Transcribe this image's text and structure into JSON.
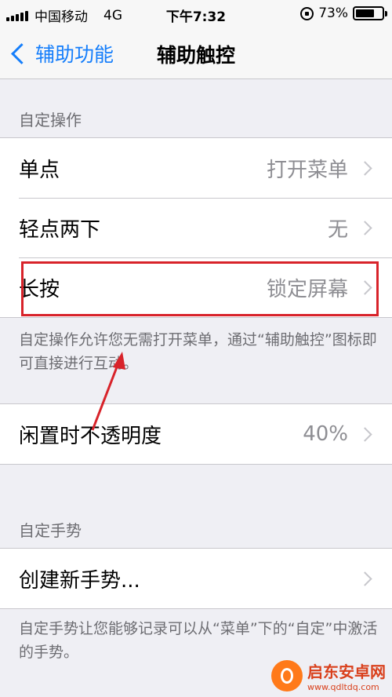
{
  "status_bar": {
    "carrier": "中国移动",
    "network": "4G",
    "time": "下午7:32",
    "battery_percent": "73%",
    "battery_level": 0.73,
    "signal_bars": 5
  },
  "nav": {
    "back_label": "辅助功能",
    "title": "辅助触控"
  },
  "custom_actions": {
    "header": "自定操作",
    "rows": [
      {
        "label": "单点",
        "value": "打开菜单"
      },
      {
        "label": "轻点两下",
        "value": "无"
      },
      {
        "label": "长按",
        "value": "锁定屏幕"
      }
    ],
    "footer": "自定操作允许您无需打开菜单，通过“辅助触控”图标即可直接进行互动。"
  },
  "opacity": {
    "label": "闲置时不透明度",
    "value": "40%"
  },
  "custom_gestures": {
    "header": "自定手势",
    "create_label": "创建新手势...",
    "footer": "自定手势让您能够记录可以从“菜单”下的“自定”中激活的手势。"
  },
  "annotation": {
    "color": "#d8232a"
  },
  "watermark": {
    "name": "启东安卓网",
    "url": "www.qdltdq.com"
  }
}
